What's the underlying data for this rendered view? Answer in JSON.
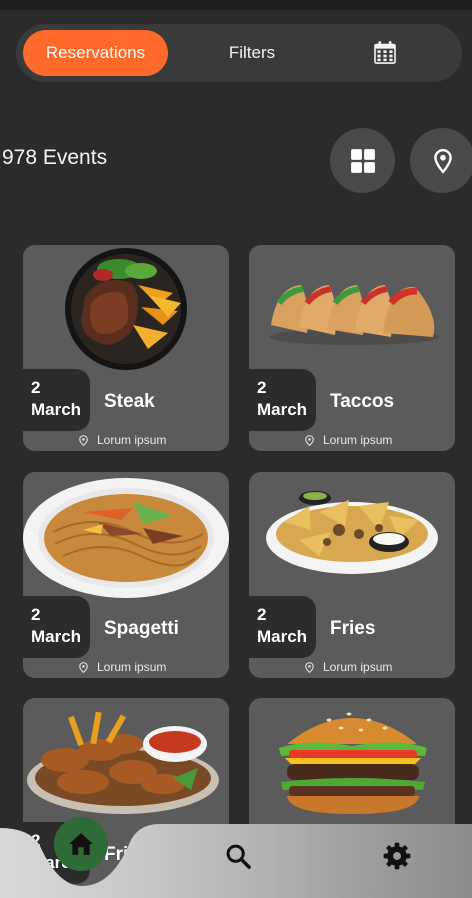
{
  "tabs": {
    "reservations": "Reservations",
    "filters": "Filters",
    "calendar_icon": "calendar-icon"
  },
  "events": {
    "count_label": "978 Events"
  },
  "actions": {
    "grid_icon": "grid-icon",
    "location_icon": "location-pin-icon"
  },
  "cards": [
    {
      "day": "2",
      "month": "March",
      "title": "Steak",
      "location": "Lorum ipsum"
    },
    {
      "day": "2",
      "month": "March",
      "title": "Taccos",
      "location": "Lorum ipsum"
    },
    {
      "day": "2",
      "month": "March",
      "title": "Spagetti",
      "location": "Lorum ipsum"
    },
    {
      "day": "2",
      "month": "March",
      "title": "Fries",
      "location": "Lorum ipsum"
    },
    {
      "day": "2",
      "month": "March",
      "title": "Fries",
      "location": ""
    },
    {
      "day": "",
      "month": "",
      "title": "",
      "location": ""
    }
  ],
  "nav": {
    "home_icon": "home-icon",
    "search_icon": "search-icon",
    "settings_icon": "gear-icon"
  },
  "colors": {
    "background": "#2b2b2b",
    "accent": "#ff6a2b",
    "card": "#5b5b5b",
    "home_button": "#2e6b36"
  }
}
